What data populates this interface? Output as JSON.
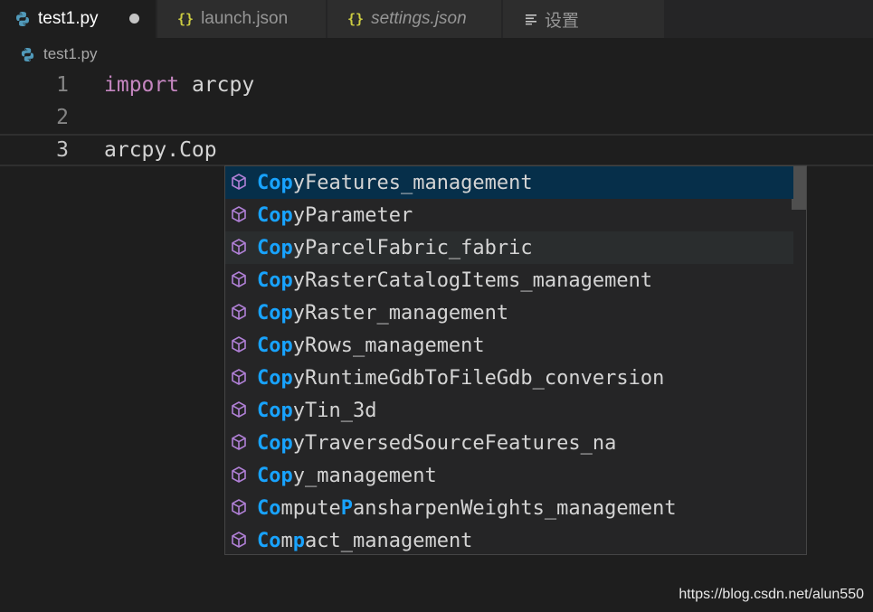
{
  "tabs": [
    {
      "label": "test1.py",
      "icon": "python-icon",
      "active": true,
      "modified": true
    },
    {
      "label": "launch.json",
      "icon": "json-braces-icon",
      "active": false,
      "italic": false
    },
    {
      "label": "settings.json",
      "icon": "json-braces-icon",
      "active": false,
      "italic": true
    },
    {
      "label": "设置",
      "icon": "settings-lines-icon",
      "active": false
    }
  ],
  "breadcrumb": {
    "file": "test1.py",
    "icon": "python-icon"
  },
  "editor": {
    "lines": [
      {
        "number": "1",
        "keyword": "import",
        "rest": " arcpy"
      },
      {
        "number": "2",
        "keyword": "",
        "rest": ""
      },
      {
        "number": "3",
        "keyword": "",
        "rest": "arcpy.Cop"
      }
    ]
  },
  "suggestions": {
    "items": [
      {
        "match": "Cop",
        "rest": "yFeatures_management",
        "state": "selected"
      },
      {
        "match": "Cop",
        "rest": "yParameter",
        "state": ""
      },
      {
        "match": "Cop",
        "rest": "yParcelFabric_fabric",
        "state": "hover"
      },
      {
        "match": "Cop",
        "rest": "yRasterCatalogItems_management",
        "state": ""
      },
      {
        "match": "Cop",
        "rest": "yRaster_management",
        "state": ""
      },
      {
        "match": "Cop",
        "rest": "yRows_management",
        "state": ""
      },
      {
        "match": "Cop",
        "rest": "yRuntimeGdbToFileGdb_conversion",
        "state": ""
      },
      {
        "match": "Cop",
        "rest": "yTin_3d",
        "state": ""
      },
      {
        "match": "Cop",
        "rest": "yTraversedSourceFeatures_na",
        "state": ""
      },
      {
        "match": "Cop",
        "rest": "y_management",
        "state": ""
      },
      {
        "segments": [
          [
            "Co",
            true
          ],
          [
            "mpute",
            false
          ],
          [
            "P",
            true
          ],
          [
            "ansharpenWeights_management",
            false
          ]
        ],
        "state": ""
      },
      {
        "segments": [
          [
            "Co",
            true
          ],
          [
            "m",
            false
          ],
          [
            "p",
            true
          ],
          [
            "act_management",
            false
          ]
        ],
        "state": ""
      }
    ],
    "item_icon": "cube-method-icon"
  },
  "colors": {
    "accent_match": "#18a3ff",
    "keyword": "#c586c0",
    "selection": "#062f4a",
    "icon_purple": "#b180d7"
  },
  "watermark": "https://blog.csdn.net/alun550"
}
